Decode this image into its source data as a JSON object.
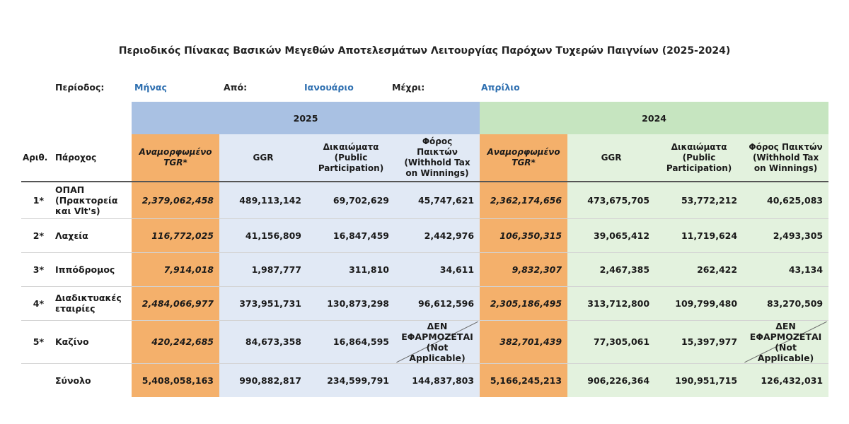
{
  "title": "Περιοδικός Πίνακας Βασικών Μεγεθών Αποτελεσμάτων Λειτουργίας Παρόχων Τυχερών Παιγνίων (2025-2024)",
  "period": {
    "period_label": "Περίοδος:",
    "period_value": "Μήνας",
    "from_label": "Από:",
    "from_value": "Ιανουάριο",
    "to_label": "Μέχρι:",
    "to_value": "Απρίλιο"
  },
  "years": {
    "y2025": "2025",
    "y2024": "2024"
  },
  "headers": {
    "num": "Αριθ.",
    "provider": "Πάροχος",
    "tgr_line1": "Αναμορφωμένο",
    "tgr_line2": "TGR*",
    "ggr": "GGR",
    "rights_line1": "Δικαιώματα",
    "rights_line2": "(Public",
    "rights_line3": "Participation)",
    "tax_line1": "Φόρος Παικτών",
    "tax_line2": "(Withhold Tax",
    "tax_line3": "on Winnings)"
  },
  "rows": [
    {
      "num": "1*",
      "provider_line1": "ΟΠΑΠ",
      "provider_line2": "(Πρακτορεία",
      "provider_line3": "και Vlt's)",
      "tgr25": "2,379,062,458",
      "ggr25": "489,113,142",
      "rights25": "69,702,629",
      "tax25": "45,747,621",
      "tgr24": "2,362,174,656",
      "ggr24": "473,675,705",
      "rights24": "53,772,212",
      "tax24": "40,625,083"
    },
    {
      "num": "2*",
      "provider_line1": "Λαχεία",
      "tgr25": "116,772,025",
      "ggr25": "41,156,809",
      "rights25": "16,847,459",
      "tax25": "2,442,976",
      "tgr24": "106,350,315",
      "ggr24": "39,065,412",
      "rights24": "11,719,624",
      "tax24": "2,493,305"
    },
    {
      "num": "3*",
      "provider_line1": "Ιππόδρομος",
      "tgr25": "7,914,018",
      "ggr25": "1,987,777",
      "rights25": "311,810",
      "tax25": "34,611",
      "tgr24": "9,832,307",
      "ggr24": "2,467,385",
      "rights24": "262,422",
      "tax24": "43,134"
    },
    {
      "num": "4*",
      "provider_line1": "Διαδικτυακές",
      "provider_line2": "εταιρίες",
      "tgr25": "2,484,066,977",
      "ggr25": "373,951,731",
      "rights25": "130,873,298",
      "tax25": "96,612,596",
      "tgr24": "2,305,186,495",
      "ggr24": "313,712,800",
      "rights24": "109,799,480",
      "tax24": "83,270,509"
    },
    {
      "num": "5*",
      "provider_line1": "Καζίνο",
      "tgr25": "420,242,685",
      "ggr25": "84,673,358",
      "rights25": "16,864,595",
      "tax25_line1": "ΔΕΝ",
      "tax25_line2": "ΕΦΑΡΜΟΖΕΤΑΙ",
      "tax25_line3": "(Not Applicable)",
      "tgr24": "382,701,439",
      "ggr24": "77,305,061",
      "rights24": "15,397,977",
      "tax24_line1": "ΔΕΝ",
      "tax24_line2": "ΕΦΑΡΜΟΖΕΤΑΙ",
      "tax24_line3": "(Not Applicable)"
    }
  ],
  "total": {
    "label": "Σύνολο",
    "tgr25": "5,408,058,163",
    "ggr25": "990,882,817",
    "rights25": "234,599,791",
    "tax25": "144,837,803",
    "tgr24": "5,166,245,213",
    "ggr24": "906,226,364",
    "rights24": "190,951,715",
    "tax24": "126,432,031"
  },
  "colors": {
    "orange": "#f4b06b",
    "blue_header": "#a9c1e3",
    "blue_light": "#e1e9f5",
    "green_header": "#c6e5c0",
    "green_light": "#e3f2de",
    "link_blue": "#2e6fb0"
  }
}
